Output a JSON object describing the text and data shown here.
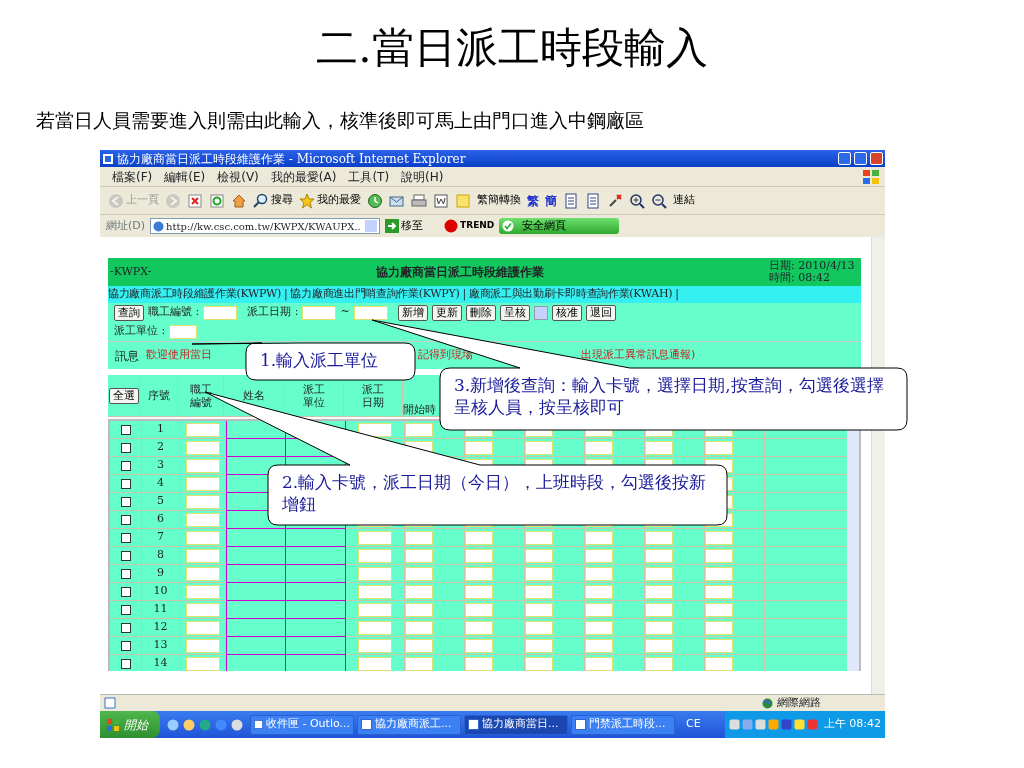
{
  "slide": {
    "title": "二.當日派工時段輸入",
    "subtitle": "若當日人員需要進入則需由此輸入，核準後即可馬上由門口進入中鋼廠區"
  },
  "window": {
    "title": "協力廠商當日派工時段維護作業 - Microsoft Internet Explorer"
  },
  "menu": [
    "檔案(F)",
    "編輯(E)",
    "檢視(V)",
    "我的最愛(A)",
    "工具(T)",
    "說明(H)"
  ],
  "toolbar": [
    {
      "kind": "back",
      "label": "上一頁",
      "disabled": true
    },
    {
      "kind": "forward",
      "disabled": true
    },
    {
      "kind": "stop"
    },
    {
      "kind": "refresh"
    },
    {
      "kind": "home"
    },
    {
      "kind": "search",
      "label": "搜尋"
    },
    {
      "kind": "favorites",
      "label": "我的最愛"
    },
    {
      "kind": "history"
    },
    {
      "kind": "mail"
    },
    {
      "kind": "print"
    },
    {
      "kind": "word"
    },
    {
      "kind": "note"
    },
    {
      "kind": "text",
      "label": "繁簡轉換"
    },
    {
      "kind": "blue",
      "label": "繁"
    },
    {
      "kind": "blue",
      "label": "簡"
    },
    {
      "kind": "doc"
    },
    {
      "kind": "doc"
    },
    {
      "kind": "tool"
    },
    {
      "kind": "zoomin"
    },
    {
      "kind": "zoomout"
    },
    {
      "kind": "text",
      "label": "連結"
    }
  ],
  "address": {
    "label": "網址(D)",
    "value": "http://kw.csc.com.tw/KWPX/KWAUPX..",
    "go": "移至",
    "trend": "TREND",
    "safe": "安全網頁"
  },
  "page": {
    "code": "-KWPX-",
    "heading": "協力廠商當日派工時段維護作業",
    "date": "日期: 2010/4/13",
    "time": "時間: 08:42",
    "links": [
      {
        "label": "協力廠商派工時段維護作業(KWPW)",
        "separator": "|"
      },
      {
        "label": "協力廠商進出門哨查詢作業(KWPY)",
        "separator": "|"
      },
      {
        "label": "廠商派工與出勤刷卡即時查詢作業(KWAH)",
        "separator": "|"
      }
    ],
    "query_button": "查詢",
    "id_label": "職工編號 :",
    "date_label": "派工日期 :",
    "range_sep": "~",
    "buttons": [
      "新增",
      "更新",
      "刪除",
      "呈核"
    ],
    "buttons2": [
      "核准",
      "退回"
    ],
    "unit_label": "派工單位 :",
    "message_label": "訊息",
    "message_parts": [
      "歡迎使用當日",
      "記得到現場",
      "出現派工異常訊息通報)"
    ],
    "select_all": "全選",
    "columns": [
      "序號",
      "職工編號",
      "姓名",
      "派工單位",
      "派工日期",
      "開始時"
    ],
    "rows": [
      {
        "no": "1",
        "checked": false
      },
      {
        "no": "2",
        "checked": false
      },
      {
        "no": "3",
        "checked": false
      },
      {
        "no": "4",
        "checked": false
      },
      {
        "no": "5",
        "checked": false
      },
      {
        "no": "6",
        "checked": false
      },
      {
        "no": "7",
        "checked": false
      },
      {
        "no": "8",
        "checked": false
      },
      {
        "no": "9",
        "checked": false
      },
      {
        "no": "10",
        "checked": false
      },
      {
        "no": "11",
        "checked": false
      },
      {
        "no": "12",
        "checked": false
      },
      {
        "no": "13",
        "checked": false
      },
      {
        "no": "14",
        "checked": false
      }
    ]
  },
  "status_bar": {
    "zone": "網際網路"
  },
  "taskbar": {
    "start": "開始",
    "tasks": [
      {
        "label": "收件匣 - Outlo...",
        "selected": false
      },
      {
        "label": "協力廠商派工...",
        "selected": false
      },
      {
        "label": "協力廠商當日...",
        "selected": true
      },
      {
        "label": "門禁派工時段...",
        "selected": false
      }
    ],
    "lang": "CE",
    "clock": "上午 08:42"
  },
  "callouts": [
    {
      "text": "1.輸入派工單位"
    },
    {
      "text": "3.新增後查詢：輸入卡號，選擇日期,按查詢，勾選後選擇呈核人員，按呈核即可"
    },
    {
      "text": "2.輸入卡號，派工日期（今日），上班時段，勾選後按新增鈕"
    }
  ]
}
